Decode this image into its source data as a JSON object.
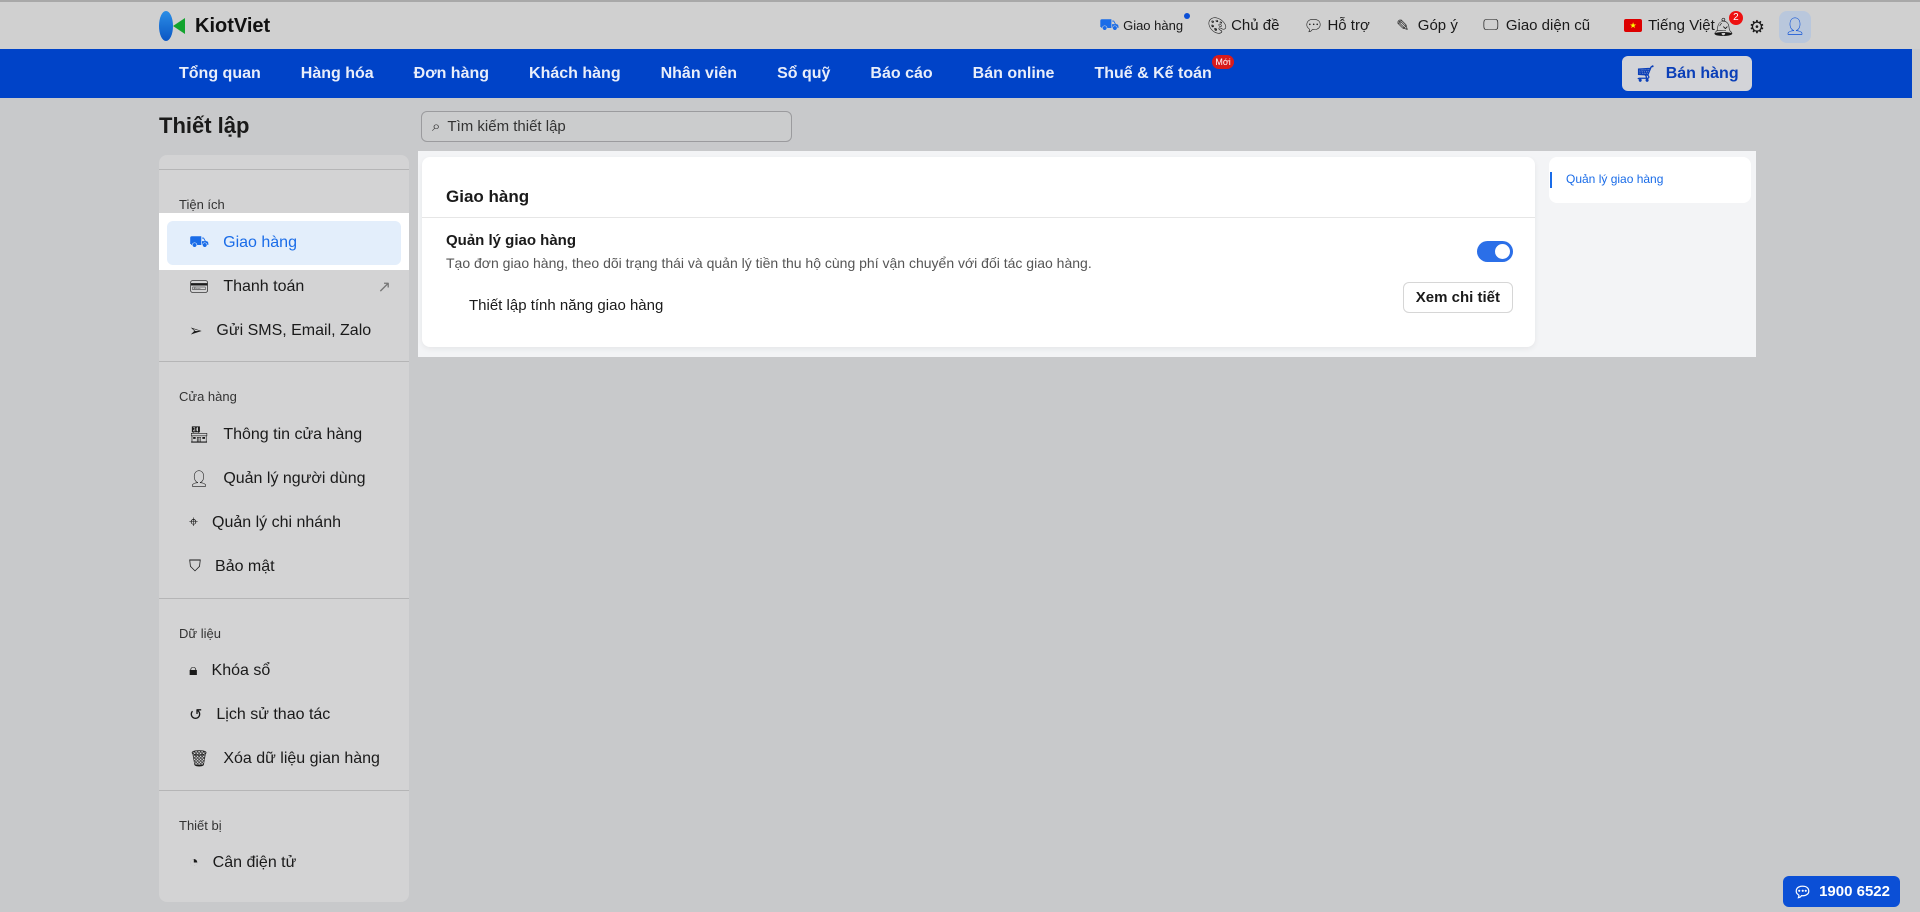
{
  "brand": "KiotViet",
  "header": {
    "delivery": "Giao hàng",
    "theme": "Chủ đề",
    "support": "Hỗ trợ",
    "feedback": "Góp ý",
    "old_ui": "Giao diện cũ",
    "language": "Tiếng Việt",
    "notifications": "2"
  },
  "nav": {
    "items": [
      "Tổng quan",
      "Hàng hóa",
      "Đơn hàng",
      "Khách hàng",
      "Nhân viên",
      "Sổ quỹ",
      "Báo cáo",
      "Bán online",
      "Thuế & Kế toán"
    ],
    "new_badge": "Mới",
    "sell": "Bán hàng"
  },
  "page": {
    "title": "Thiết lập",
    "search_placeholder": "Tìm kiếm thiết lập"
  },
  "sidebar": {
    "sections": [
      "Tiện ích",
      "Cửa hàng",
      "Dữ liệu",
      "Thiết bị"
    ],
    "items": [
      "Giao hàng",
      "Thanh toán",
      "Gửi SMS, Email, Zalo",
      "Thông tin cửa hàng",
      "Quản lý người dùng",
      "Quản lý chi nhánh",
      "Bảo mật",
      "Khóa sổ",
      "Lịch sử thao tác",
      "Xóa dữ liệu gian hàng",
      "Cân điện tử"
    ]
  },
  "content": {
    "title": "Giao hàng",
    "feature_title": "Quản lý giao hàng",
    "feature_desc": "Tạo đơn giao hàng, theo dõi trạng thái và quản lý tiền thu hộ cùng phí vận chuyển với đối tác giao hàng.",
    "toggle_on": true,
    "sub_label": "Thiết lập tính năng giao hàng",
    "detail_button": "Xem chi tiết",
    "toc": "Quản lý giao hàng"
  },
  "hotline": "1900 6522"
}
